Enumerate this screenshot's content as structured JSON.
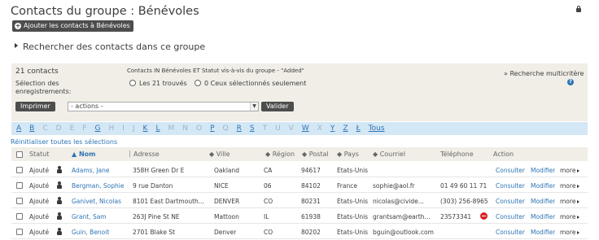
{
  "header": {
    "title": "Contacts du groupe : Bénévoles",
    "lock_icon": "lock-icon",
    "add_button": "Ajouter les contacts à Bénévoles"
  },
  "search_toggle": "Rechercher des contacts dans ce groupe",
  "criteria": {
    "count": "21 contacts",
    "criteria_text": "Contacts IN Bénévoles ET Statut vis-à-vis du groupe - \"Added\"",
    "selection_label_1": "Sélection des",
    "selection_label_2": "enregistrements:",
    "radio_all": "Les 21 trouvés",
    "radio_selected": "0 Ceux sélectionnés seulement",
    "print_button": "Imprimer",
    "actions_select": "- actions -",
    "validate_button": "Valider",
    "advanced_link": "» Recherche multicritère"
  },
  "alphabet": [
    {
      "letter": "A",
      "active": true
    },
    {
      "letter": "B",
      "active": true
    },
    {
      "letter": "C",
      "active": false
    },
    {
      "letter": "D",
      "active": false
    },
    {
      "letter": "E",
      "active": false
    },
    {
      "letter": "F",
      "active": false
    },
    {
      "letter": "G",
      "active": true
    },
    {
      "letter": "H",
      "active": false
    },
    {
      "letter": "I",
      "active": false
    },
    {
      "letter": "J",
      "active": false
    },
    {
      "letter": "K",
      "active": true
    },
    {
      "letter": "L",
      "active": true
    },
    {
      "letter": "M",
      "active": false
    },
    {
      "letter": "N",
      "active": false
    },
    {
      "letter": "O",
      "active": false
    },
    {
      "letter": "P",
      "active": true
    },
    {
      "letter": "Q",
      "active": false
    },
    {
      "letter": "R",
      "active": true
    },
    {
      "letter": "S",
      "active": true
    },
    {
      "letter": "T",
      "active": false
    },
    {
      "letter": "U",
      "active": false
    },
    {
      "letter": "V",
      "active": false
    },
    {
      "letter": "W",
      "active": true
    },
    {
      "letter": "X",
      "active": false
    },
    {
      "letter": "Y",
      "active": true
    },
    {
      "letter": "Z",
      "active": true
    },
    {
      "letter": "Ł",
      "active": true
    },
    {
      "letter": "Tous",
      "active": true
    }
  ],
  "reset_link": "Réinitialiser toutes les sélections",
  "table": {
    "columns": [
      "Statut",
      "Nom",
      "Adresse",
      "Ville",
      "Région",
      "Postal",
      "Pays",
      "Courriel",
      "Téléphone",
      "Action"
    ],
    "sorted_column": "Nom",
    "rows": [
      {
        "statut": "Ajouté",
        "nom": "Adams, Jane",
        "adresse": "358H Green Dr E",
        "ville": "Oakland",
        "region": "CA",
        "postal": "94617",
        "pays": "États-Unis",
        "courriel": "",
        "telephone": "",
        "blocked": false
      },
      {
        "statut": "Ajouté",
        "nom": "Bergman, Sophie",
        "adresse": "9 rue Danton",
        "ville": "NICE",
        "region": "06",
        "postal": "84102",
        "pays": "France",
        "courriel": "sophie@aol.fr",
        "telephone": "01 49 60 11 71",
        "blocked": false
      },
      {
        "statut": "Ajouté",
        "nom": "Ganivet, Nicolas",
        "adresse": "8101 East Dartmouth...",
        "ville": "DENVER",
        "region": "CO",
        "postal": "80231",
        "pays": "États-Unis",
        "courriel": "nicolas@civide...",
        "telephone": "(303) 256-8965",
        "blocked": false
      },
      {
        "statut": "Ajouté",
        "nom": "Grant, Sam",
        "adresse": "263J Pine St NE",
        "ville": "Mattoon",
        "region": "IL",
        "postal": "61938",
        "pays": "États-Unis",
        "courriel": "grantsam@earth...",
        "telephone": "23573341",
        "blocked": true
      },
      {
        "statut": "Ajouté",
        "nom": "Guin, Benoit",
        "adresse": "2701 Blake St",
        "ville": "Denver",
        "region": "CO",
        "postal": "80202",
        "pays": "États-Unis",
        "courriel": "bguin@outlook.com",
        "telephone": "",
        "blocked": false
      }
    ],
    "action_view": "Consulter",
    "action_edit": "Modifier",
    "action_more": "more"
  }
}
